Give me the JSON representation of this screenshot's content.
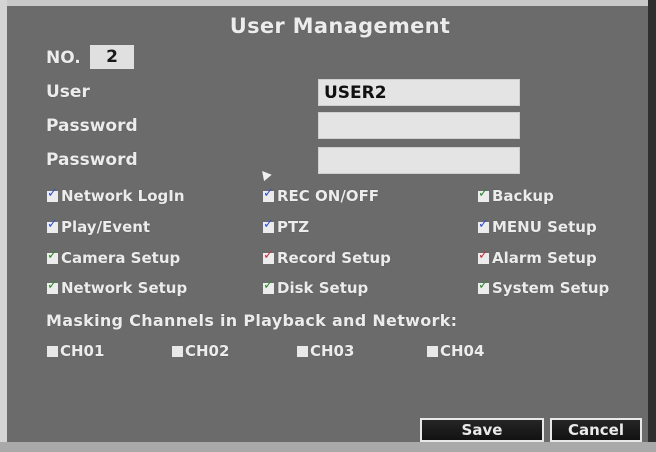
{
  "dialog": {
    "title": "User Management"
  },
  "number": {
    "label": "NO.",
    "value": "2"
  },
  "fields": {
    "user": {
      "label": "User",
      "value": "USER2"
    },
    "password": {
      "label": "Password",
      "value": ""
    },
    "password_confirm": {
      "label": "Password",
      "value": ""
    }
  },
  "permissions": [
    {
      "label": "Network LogIn",
      "checked": true
    },
    {
      "label": "REC ON/OFF",
      "checked": true
    },
    {
      "label": "Backup",
      "checked": true
    },
    {
      "label": "Play/Event",
      "checked": true
    },
    {
      "label": "PTZ",
      "checked": true
    },
    {
      "label": "MENU Setup",
      "checked": true
    },
    {
      "label": "Camera Setup",
      "checked": true
    },
    {
      "label": "Record Setup",
      "checked": true
    },
    {
      "label": "Alarm Setup",
      "checked": true
    },
    {
      "label": "Network Setup",
      "checked": true
    },
    {
      "label": "Disk Setup",
      "checked": true
    },
    {
      "label": "System Setup",
      "checked": true
    }
  ],
  "masking": {
    "title": "Masking Channels in Playback and Network:",
    "channels": [
      {
        "label": "CH01",
        "checked": false
      },
      {
        "label": "CH02",
        "checked": false
      },
      {
        "label": "CH03",
        "checked": false
      },
      {
        "label": "CH04",
        "checked": false
      }
    ]
  },
  "buttons": {
    "save": "Save",
    "cancel": "Cancel"
  },
  "colors": {
    "background": "#6b6b6b",
    "text": "#ececec",
    "field": "#e4e4e4",
    "button": "#1a1a1a"
  }
}
